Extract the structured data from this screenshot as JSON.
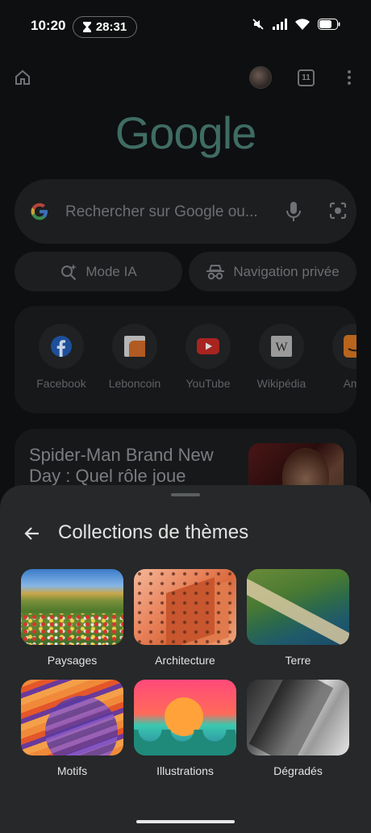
{
  "status_bar": {
    "time": "10:20",
    "timer": "28:31"
  },
  "browser": {
    "tab_count": "11",
    "logo": "Google",
    "search": {
      "placeholder": "Rechercher sur Google ou..."
    },
    "chips": {
      "ai_mode": "Mode IA",
      "incognito": "Navigation privée"
    },
    "shortcuts": [
      {
        "label": "Facebook",
        "icon": "facebook-icon"
      },
      {
        "label": "Leboncoin",
        "icon": "leboncoin-icon"
      },
      {
        "label": "YouTube",
        "icon": "youtube-icon"
      },
      {
        "label": "Wikipédia",
        "icon": "wikipedia-icon"
      },
      {
        "label": "Ama",
        "icon": "amazon-icon"
      }
    ],
    "news": {
      "headline": "Spider-Man Brand New Day : Quel rôle joue"
    }
  },
  "sheet": {
    "title": "Collections de thèmes",
    "collections": [
      {
        "label": "Paysages"
      },
      {
        "label": "Architecture"
      },
      {
        "label": "Terre"
      },
      {
        "label": "Motifs"
      },
      {
        "label": "Illustrations"
      },
      {
        "label": "Dégradés"
      }
    ]
  },
  "colors": {
    "sheet_bg": "#262829",
    "page_bg": "#0e0f10",
    "text": "#e3e3e3"
  }
}
